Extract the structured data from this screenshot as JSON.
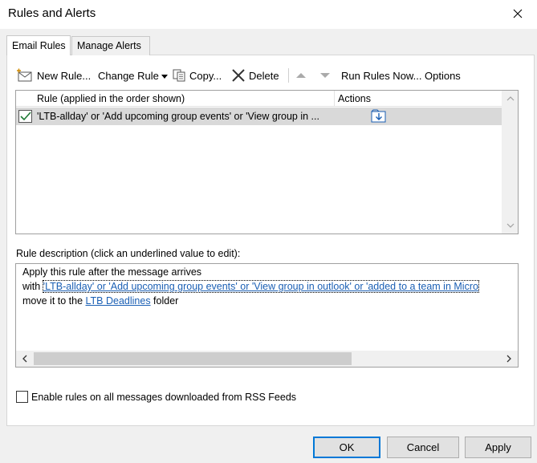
{
  "window": {
    "title": "Rules and Alerts"
  },
  "tabs": [
    {
      "label": "Email Rules"
    },
    {
      "label": "Manage Alerts"
    }
  ],
  "toolbar": {
    "new_rule": "New Rule...",
    "change_rule": "Change Rule",
    "copy": "Copy...",
    "delete": "Delete",
    "run_rules_now": "Run Rules Now...",
    "options": "Options"
  },
  "rules_list": {
    "columns": {
      "rule": "Rule (applied in the order shown)",
      "actions": "Actions"
    },
    "rows": [
      {
        "checked": true,
        "name": "'LTB-allday' or 'Add upcoming group events' or 'View group in ..."
      }
    ]
  },
  "description": {
    "label": "Rule description (click an underlined value to edit):",
    "line1": "Apply this rule after the message arrives",
    "line2_prefix": "with ",
    "line2_link": "'LTB-allday' or 'Add upcoming group events' or 'View group in outlook' or 'added to a team in Micro",
    "line3_prefix": "move it to the ",
    "line3_link": "LTB Deadlines",
    "line3_suffix": " folder"
  },
  "rss": {
    "label": "Enable rules on all messages downloaded from RSS Feeds",
    "checked": false
  },
  "buttons": {
    "ok": "OK",
    "cancel": "Cancel",
    "apply": "Apply"
  },
  "colors": {
    "accent": "#0078d7",
    "link": "#1a5fb4",
    "selection": "#d9d9d9"
  }
}
